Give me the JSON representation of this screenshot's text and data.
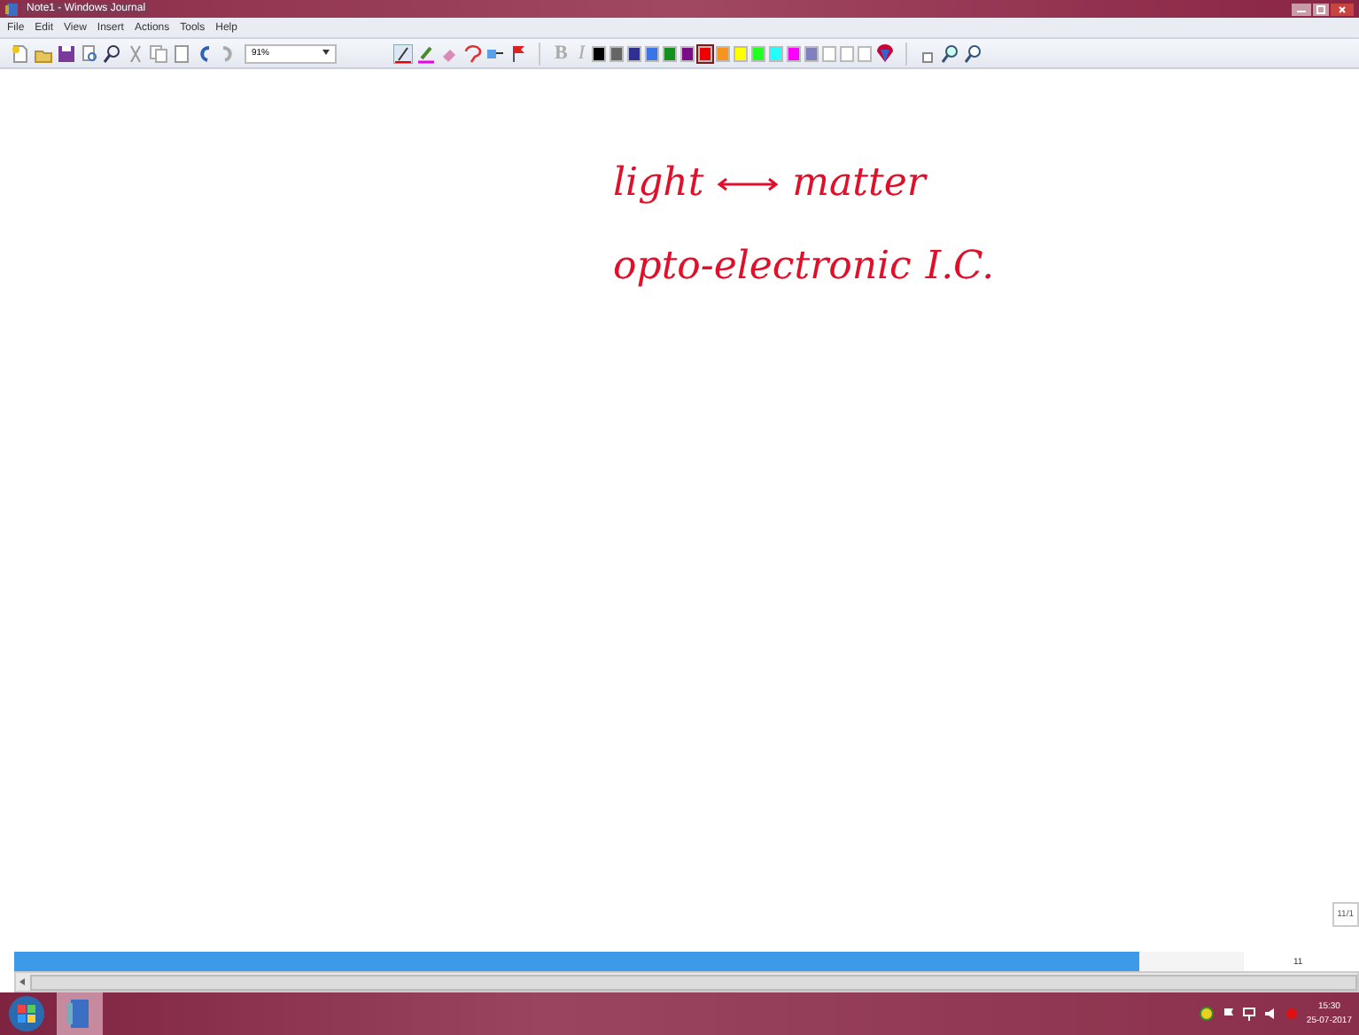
{
  "window": {
    "title": "Note1 - Windows Journal"
  },
  "menu": [
    "File",
    "Edit",
    "View",
    "Insert",
    "Actions",
    "Tools",
    "Help"
  ],
  "toolbar": {
    "zoom": "91%",
    "bold": "B",
    "italic": "I",
    "palette": [
      {
        "color": "#000000",
        "selected": false
      },
      {
        "color": "#666666",
        "selected": false
      },
      {
        "color": "#2e3192",
        "selected": false
      },
      {
        "color": "#3a75e8",
        "selected": false
      },
      {
        "color": "#12911f",
        "selected": false
      },
      {
        "color": "#7a0c87",
        "selected": false
      },
      {
        "color": "#ee0000",
        "selected": true
      },
      {
        "color": "#f7941d",
        "selected": false
      },
      {
        "color": "#ffff00",
        "selected": false
      },
      {
        "color": "#22ff22",
        "selected": false
      },
      {
        "color": "#22ffff",
        "selected": false
      },
      {
        "color": "#ff00ff",
        "selected": false
      },
      {
        "color": "#8080c0",
        "selected": false
      },
      {
        "color": "#ffffff",
        "selected": false
      },
      {
        "color": "#ffffff",
        "selected": false
      },
      {
        "color": "#ffffff",
        "selected": false
      }
    ]
  },
  "note": {
    "ink": [
      {
        "kind": "word",
        "text": "light"
      },
      {
        "kind": "arrow"
      },
      {
        "kind": "word",
        "text": "matter"
      },
      {
        "kind": "break"
      },
      {
        "kind": "word",
        "text": "opto-electronic"
      },
      {
        "kind": "word",
        "text": "I.C."
      }
    ],
    "page_indicator": "11/1",
    "progress": {
      "level": 0.915
    },
    "page_number": "11"
  },
  "taskbar": {
    "time": "15:30",
    "date": "25-07-2017"
  }
}
